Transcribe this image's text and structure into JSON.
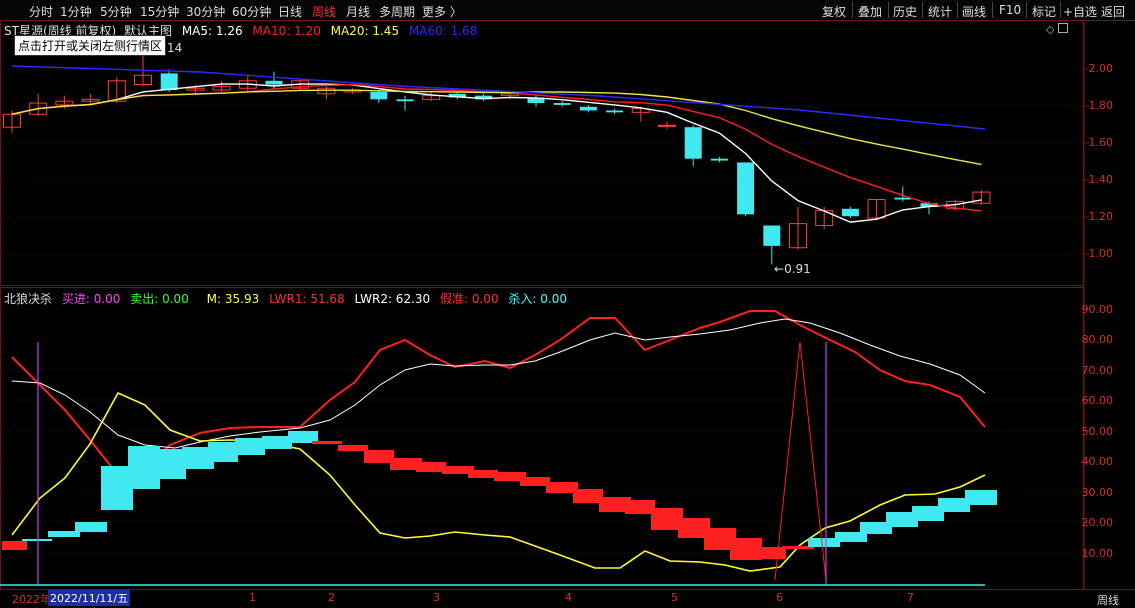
{
  "toolbar": {
    "tabs": [
      "分时",
      "1分钟",
      "5分钟",
      "15分钟",
      "30分钟",
      "60分钟",
      "日线",
      "周线",
      "月线",
      "多周期",
      "更多 〉"
    ],
    "active": "周线",
    "right_buttons": [
      "复权",
      "叠加",
      "历史",
      "统计",
      "画线",
      "F10",
      "标记",
      "+自选",
      "返回"
    ]
  },
  "main_panel": {
    "title": "ST星源(周线 前复权)",
    "indicator": "默认主图",
    "ma": [
      {
        "label": "MA5: 1.26",
        "color": "#ffffff"
      },
      {
        "label": "MA10: 1.20",
        "color": "#ff2020"
      },
      {
        "label": "MA20: 1.45",
        "color": "#ffff40"
      },
      {
        "label": "MA60: 1.68",
        "color": "#2a2aff"
      }
    ],
    "tooltip": "点击打开或关闭左侧行情区",
    "high_label": "14",
    "low_label": "0.91",
    "y_ticks": [
      "2.00",
      "1.80",
      "1.60",
      "1.40",
      "1.20",
      "1.00"
    ]
  },
  "sub_panel": {
    "title": "北狼决杀",
    "fields": [
      {
        "label": "买进: 0.00",
        "color": "#ff40ff"
      },
      {
        "label": "卖出: 0.00",
        "color": "#30ff30"
      },
      {
        "label": "M: 35.93",
        "color": "#ffff40"
      },
      {
        "label": "LWR1: 51.68",
        "color": "#ff3030"
      },
      {
        "label": "LWR2: 62.30",
        "color": "#ffffff"
      },
      {
        "label": "假准: 0.00",
        "color": "#ff3030"
      },
      {
        "label": "杀入: 0.00",
        "color": "#40ffff"
      }
    ],
    "y_ticks": [
      "90.00",
      "80.00",
      "70.00",
      "60.00",
      "50.00",
      "40.00",
      "30.00",
      "20.00",
      "10.00"
    ]
  },
  "x_axis": {
    "partial_year": "2022年",
    "selected_date": "2022/11/11/五",
    "months": [
      "1",
      "2",
      "3",
      "4",
      "5",
      "6",
      "7"
    ],
    "period": "周线"
  },
  "chart_data": {
    "type": "candlestick",
    "ylim": [
      0.88,
      2.12
    ],
    "candles": [
      {
        "o": 1.65,
        "c": 1.72,
        "h": 1.74,
        "l": 1.62
      },
      {
        "o": 1.72,
        "c": 1.78,
        "h": 1.83,
        "l": 1.71
      },
      {
        "o": 1.77,
        "c": 1.79,
        "h": 1.82,
        "l": 1.75
      },
      {
        "o": 1.79,
        "c": 1.8,
        "h": 1.83,
        "l": 1.77
      },
      {
        "o": 1.79,
        "c": 1.9,
        "h": 1.92,
        "l": 1.78
      },
      {
        "o": 1.88,
        "c": 1.93,
        "h": 2.14,
        "l": 1.87
      },
      {
        "o": 1.94,
        "c": 1.85,
        "h": 1.96,
        "l": 1.84
      },
      {
        "o": 1.85,
        "c": 1.86,
        "h": 1.88,
        "l": 1.83
      },
      {
        "o": 1.85,
        "c": 1.87,
        "h": 1.9,
        "l": 1.84
      },
      {
        "o": 1.86,
        "c": 1.9,
        "h": 1.93,
        "l": 1.84
      },
      {
        "o": 1.9,
        "c": 1.88,
        "h": 1.95,
        "l": 1.86
      },
      {
        "o": 1.86,
        "c": 1.9,
        "h": 1.91,
        "l": 1.85
      },
      {
        "o": 1.83,
        "c": 1.86,
        "h": 1.87,
        "l": 1.8
      },
      {
        "o": 1.84,
        "c": 1.85,
        "h": 1.86,
        "l": 1.83
      },
      {
        "o": 1.84,
        "c": 1.8,
        "h": 1.85,
        "l": 1.78
      },
      {
        "o": 1.8,
        "c": 1.79,
        "h": 1.82,
        "l": 1.74
      },
      {
        "o": 1.8,
        "c": 1.82,
        "h": 1.84,
        "l": 1.79
      },
      {
        "o": 1.83,
        "c": 1.81,
        "h": 1.84,
        "l": 1.8
      },
      {
        "o": 1.82,
        "c": 1.8,
        "h": 1.83,
        "l": 1.79
      },
      {
        "o": 1.82,
        "c": 1.83,
        "h": 1.84,
        "l": 1.8
      },
      {
        "o": 1.81,
        "c": 1.78,
        "h": 1.82,
        "l": 1.76
      },
      {
        "o": 1.78,
        "c": 1.77,
        "h": 1.79,
        "l": 1.76
      },
      {
        "o": 1.76,
        "c": 1.74,
        "h": 1.77,
        "l": 1.73
      },
      {
        "o": 1.74,
        "c": 1.73,
        "h": 1.75,
        "l": 1.72
      },
      {
        "o": 1.73,
        "c": 1.75,
        "h": 1.76,
        "l": 1.68
      },
      {
        "o": 1.66,
        "c": 1.66,
        "h": 1.68,
        "l": 1.64
      },
      {
        "o": 1.65,
        "c": 1.48,
        "h": 1.66,
        "l": 1.44
      },
      {
        "o": 1.48,
        "c": 1.47,
        "h": 1.49,
        "l": 1.46
      },
      {
        "o": 1.46,
        "c": 1.18,
        "h": 1.46,
        "l": 1.17
      },
      {
        "o": 1.12,
        "c": 1.01,
        "h": 1.12,
        "l": 0.91
      },
      {
        "o": 1.0,
        "c": 1.13,
        "h": 1.22,
        "l": 0.99
      },
      {
        "o": 1.12,
        "c": 1.2,
        "h": 1.22,
        "l": 1.1
      },
      {
        "o": 1.21,
        "c": 1.17,
        "h": 1.22,
        "l": 1.16
      },
      {
        "o": 1.16,
        "c": 1.26,
        "h": 1.26,
        "l": 1.15
      },
      {
        "o": 1.27,
        "c": 1.26,
        "h": 1.33,
        "l": 1.25
      },
      {
        "o": 1.24,
        "c": 1.22,
        "h": 1.25,
        "l": 1.18
      },
      {
        "o": 1.21,
        "c": 1.25,
        "h": 1.26,
        "l": 1.2
      },
      {
        "o": 1.24,
        "c": 1.3,
        "h": 1.31,
        "l": 1.23
      }
    ]
  },
  "colors": {
    "up": "#ff3c3c",
    "down": "#40e8f0",
    "axis": "#7a1010"
  }
}
